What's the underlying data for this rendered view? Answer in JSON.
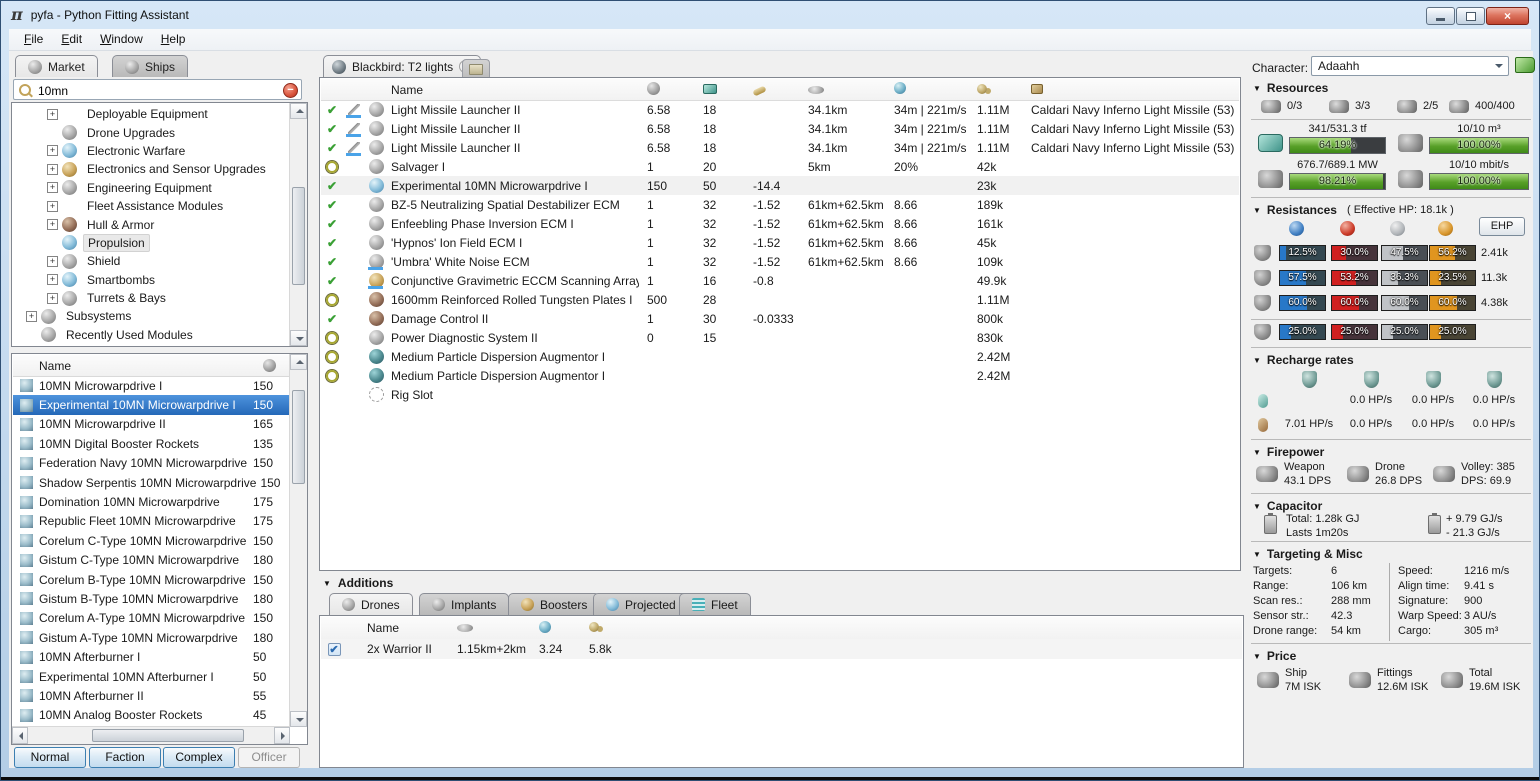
{
  "colors": {
    "selection_blue": "#2f79c8",
    "gauge_green": "#58a028",
    "em": "#2878c8",
    "thermal": "#d02020",
    "kinetic": "#c0c3c7",
    "explosive": "#e0951f",
    "close_button": "#c04530",
    "charge_underline": "#4aa3e8"
  },
  "window": {
    "title": "pyfa - Python Fitting Assistant"
  },
  "menu": {
    "items": [
      {
        "label": "File"
      },
      {
        "label": "Edit"
      },
      {
        "label": "Window"
      },
      {
        "label": "Help"
      }
    ]
  },
  "left_panel": {
    "tabs": [
      {
        "label": "Market",
        "icon": "market-tab-icon",
        "active": true
      },
      {
        "label": "Ships",
        "icon": "ships-tab-icon",
        "active": false
      }
    ],
    "search": {
      "value": "10mn"
    },
    "tree": {
      "items": [
        {
          "label": "Deployable Equipment",
          "plus": true,
          "icon": "",
          "indent": "ind1"
        },
        {
          "label": "Drone Upgrades",
          "plus": false,
          "icon": "drone-upgrades-icon",
          "indent": "ind1"
        },
        {
          "label": "Electronic Warfare",
          "plus": true,
          "icon": "electronic-warfare-icon",
          "indent": "ind1"
        },
        {
          "label": "Electronics and Sensor Upgrades",
          "plus": true,
          "icon": "sensor-upgrades-icon",
          "indent": "ind1"
        },
        {
          "label": "Engineering Equipment",
          "plus": true,
          "icon": "engineering-icon",
          "indent": "ind1"
        },
        {
          "label": "Fleet Assistance Modules",
          "plus": true,
          "icon": "",
          "indent": "ind1"
        },
        {
          "label": "Hull & Armor",
          "plus": true,
          "icon": "hull-armor-icon",
          "indent": "ind1"
        },
        {
          "label": "Propulsion",
          "plus": false,
          "icon": "propulsion-icon",
          "indent": "ind1",
          "selected": true
        },
        {
          "label": "Shield",
          "plus": true,
          "icon": "shield-group-icon",
          "indent": "ind1"
        },
        {
          "label": "Smartbombs",
          "plus": true,
          "icon": "smartbombs-icon",
          "indent": "ind1"
        },
        {
          "label": "Turrets & Bays",
          "plus": true,
          "icon": "turrets-icon",
          "indent": "ind1"
        },
        {
          "label": "Subsystems",
          "plus": true,
          "icon": "subsystems-icon",
          "indent": "ind0"
        },
        {
          "label": "Recently Used Modules",
          "plus": false,
          "icon": "recent-modules-icon",
          "indent": "ind0"
        }
      ]
    },
    "market_list": {
      "name_header": "Name",
      "items": [
        {
          "name": "10MN Microwarpdrive I",
          "pg": "150"
        },
        {
          "name": "Experimental 10MN Microwarpdrive I",
          "pg": "150",
          "selected": true
        },
        {
          "name": "10MN Microwarpdrive II",
          "pg": "165"
        },
        {
          "name": "10MN Digital Booster Rockets",
          "pg": "135"
        },
        {
          "name": "Federation Navy 10MN Microwarpdrive",
          "pg": "150"
        },
        {
          "name": "Shadow Serpentis 10MN Microwarpdrive",
          "pg": "150"
        },
        {
          "name": "Domination 10MN Microwarpdrive",
          "pg": "175"
        },
        {
          "name": "Republic Fleet 10MN Microwarpdrive",
          "pg": "175"
        },
        {
          "name": "Corelum C-Type 10MN Microwarpdrive",
          "pg": "150"
        },
        {
          "name": "Gistum C-Type 10MN Microwarpdrive",
          "pg": "180"
        },
        {
          "name": "Corelum B-Type 10MN Microwarpdrive",
          "pg": "150"
        },
        {
          "name": "Gistum B-Type 10MN Microwarpdrive",
          "pg": "180"
        },
        {
          "name": "Corelum A-Type 10MN Microwarpdrive",
          "pg": "150"
        },
        {
          "name": "Gistum A-Type 10MN Microwarpdrive",
          "pg": "180"
        },
        {
          "name": "10MN Afterburner I",
          "pg": "50"
        },
        {
          "name": "Experimental 10MN Afterburner I",
          "pg": "50"
        },
        {
          "name": "10MN Afterburner II",
          "pg": "55"
        },
        {
          "name": "10MN Analog Booster Rockets",
          "pg": "45"
        }
      ]
    },
    "meta_buttons": [
      {
        "label": "Normal",
        "active": true
      },
      {
        "label": "Faction",
        "active": true
      },
      {
        "label": "Complex",
        "active": true
      },
      {
        "label": "Officer",
        "disabled": true
      }
    ]
  },
  "center": {
    "fit_tab": {
      "label": "Blackbird: T2 lights"
    },
    "fitting": {
      "name_header": "Name",
      "rows": [
        {
          "act": true,
          "charge": true,
          "charge_ul": true,
          "icon": "missile-launcher-icon",
          "name": "Light Missile Launcher II",
          "pg": "6.58",
          "cpu": "18",
          "cap": "",
          "range": "34.1km",
          "falloff": "34m | 221m/s",
          "price": "1.11M",
          "ammo": "Caldari Navy Inferno Light Missile (53)"
        },
        {
          "act": true,
          "charge": true,
          "charge_ul": true,
          "icon": "missile-launcher-icon",
          "name": "Light Missile Launcher II",
          "pg": "6.58",
          "cpu": "18",
          "cap": "",
          "range": "34.1km",
          "falloff": "34m | 221m/s",
          "price": "1.11M",
          "ammo": "Caldari Navy Inferno Light Missile (53)"
        },
        {
          "act": true,
          "charge": true,
          "charge_ul": true,
          "icon": "missile-launcher-icon",
          "name": "Light Missile Launcher II",
          "pg": "6.58",
          "cpu": "18",
          "cap": "",
          "range": "34.1km",
          "falloff": "34m | 221m/s",
          "price": "1.11M",
          "ammo": "Caldari Navy Inferno Light Missile (53)"
        },
        {
          "off": true,
          "icon": "salvager-icon",
          "name": "Salvager I",
          "pg": "1",
          "cpu": "20",
          "cap": "",
          "range": "5km",
          "falloff": "20%",
          "price": "42k",
          "ammo": ""
        },
        {
          "act": true,
          "selected": true,
          "icon": "mwd-icon",
          "name": "Experimental 10MN Microwarpdrive I",
          "pg": "150",
          "cpu": "50",
          "cap": "-14.4",
          "range": "",
          "falloff": "",
          "price": "23k",
          "ammo": ""
        },
        {
          "act": true,
          "icon": "ecm-icon",
          "name": "BZ-5 Neutralizing Spatial Destabilizer ECM",
          "pg": "1",
          "cpu": "32",
          "cap": "-1.52",
          "range": "61km+62.5km",
          "falloff": "8.66",
          "price": "189k",
          "ammo": ""
        },
        {
          "act": true,
          "icon": "ecm-icon",
          "name": "Enfeebling Phase Inversion ECM I",
          "pg": "1",
          "cpu": "32",
          "cap": "-1.52",
          "range": "61km+62.5km",
          "falloff": "8.66",
          "price": "161k",
          "ammo": ""
        },
        {
          "act": true,
          "icon": "ecm-icon",
          "name": "'Hypnos' Ion Field ECM I",
          "pg": "1",
          "cpu": "32",
          "cap": "-1.52",
          "range": "61km+62.5km",
          "falloff": "8.66",
          "price": "45k",
          "ammo": ""
        },
        {
          "act": true,
          "icon_ul": true,
          "icon": "ecm-icon",
          "name": "'Umbra' White Noise ECM",
          "pg": "1",
          "cpu": "32",
          "cap": "-1.52",
          "range": "61km+62.5km",
          "falloff": "8.66",
          "price": "109k",
          "ammo": ""
        },
        {
          "act": true,
          "icon_ul": true,
          "icon": "eccm-icon",
          "name": "Conjunctive Gravimetric ECCM Scanning Array I",
          "pg": "1",
          "cpu": "16",
          "cap": "-0.8",
          "range": "",
          "falloff": "",
          "price": "49.9k",
          "ammo": ""
        },
        {
          "off": true,
          "icon": "armor-plate-icon",
          "name": "1600mm Reinforced Rolled Tungsten Plates I",
          "pg": "500",
          "cpu": "28",
          "cap": "",
          "range": "",
          "falloff": "",
          "price": "1.11M",
          "ammo": ""
        },
        {
          "act": true,
          "icon": "damage-control-icon",
          "name": "Damage Control II",
          "pg": "1",
          "cpu": "30",
          "cap": "-0.0333",
          "range": "",
          "falloff": "",
          "price": "800k",
          "ammo": ""
        },
        {
          "off": true,
          "icon": "pds-icon",
          "name": "Power Diagnostic System II",
          "pg": "0",
          "cpu": "15",
          "cap": "",
          "range": "",
          "falloff": "",
          "price": "830k",
          "ammo": ""
        },
        {
          "off": true,
          "icon": "rig-augmentor-icon",
          "name": "Medium Particle Dispersion Augmentor I",
          "pg": "",
          "cpu": "",
          "cap": "",
          "range": "",
          "falloff": "",
          "price": "2.42M",
          "ammo": ""
        },
        {
          "off": true,
          "icon": "rig-augmentor-icon",
          "name": "Medium Particle Dispersion Augmentor I",
          "pg": "",
          "cpu": "",
          "cap": "",
          "range": "",
          "falloff": "",
          "price": "2.42M",
          "ammo": ""
        },
        {
          "icon": "rig-slot-icon",
          "name": "Rig Slot",
          "pg": "",
          "cpu": "",
          "cap": "",
          "range": "",
          "falloff": "",
          "price": "",
          "ammo": ""
        }
      ]
    },
    "additions": {
      "label": "Additions",
      "tabs": [
        {
          "label": "Drones",
          "icon": "drones-tab-icon",
          "active": true
        },
        {
          "label": "Implants",
          "icon": "implants-tab-icon"
        },
        {
          "label": "Boosters",
          "icon": "boosters-tab-icon"
        },
        {
          "label": "Projected",
          "icon": "projected-tab-icon"
        },
        {
          "label": "Fleet",
          "icon": "fleet-tab-icon"
        }
      ],
      "drones": {
        "name_header": "Name",
        "rows": [
          {
            "checked": true,
            "name": "2x Warrior II",
            "range": "1.15km+2km",
            "tracking": "3.24",
            "price": "5.8k"
          }
        ]
      }
    }
  },
  "right_panel": {
    "character": {
      "label": "Character:",
      "value": "Adaahh"
    },
    "resources": {
      "title": "Resources",
      "slots": [
        {
          "icon": "turret-hardpoints-icon",
          "value": "0/3"
        },
        {
          "icon": "launcher-hardpoints-icon",
          "value": "3/3"
        },
        {
          "icon": "calibration-icon",
          "value": "2/5"
        },
        {
          "icon": "drone-capacity-icon",
          "value": "400/400"
        }
      ],
      "gauges": [
        {
          "icon": "cpu-icon",
          "label": "341/531.3 tf",
          "pct": 64.19,
          "text": "64.19%"
        },
        {
          "icon": "dronebay-icon",
          "label": "10/10 m³",
          "pct": 100,
          "text": "100.00%"
        },
        {
          "icon": "powergrid-icon",
          "label": "676.7/689.1 MW",
          "pct": 98.21,
          "text": "98.21%"
        },
        {
          "icon": "bandwidth-icon",
          "label": "10/10 mbit/s",
          "pct": 100,
          "text": "100.00%"
        }
      ]
    },
    "resistances": {
      "title": "Resistances",
      "subtitle": "( Effective HP: 18.1k )",
      "ehp_button": "EHP",
      "rows": [
        {
          "icon": "shield-resist-icon",
          "cells": [
            {
              "type": "em",
              "value": "12.5%"
            },
            {
              "type": "thermal",
              "value": "30.0%"
            },
            {
              "type": "kinetic",
              "value": "47.5%"
            },
            {
              "type": "explosive",
              "value": "56.2%"
            }
          ],
          "ehp": "2.41k"
        },
        {
          "icon": "armor-resist-icon",
          "cells": [
            {
              "type": "em",
              "value": "57.5%"
            },
            {
              "type": "thermal",
              "value": "53.2%"
            },
            {
              "type": "kinetic",
              "value": "36.3%"
            },
            {
              "type": "explosive",
              "value": "23.5%"
            }
          ],
          "ehp": "11.3k"
        },
        {
          "icon": "hull-resist-icon",
          "cells": [
            {
              "type": "em",
              "value": "60.0%"
            },
            {
              "type": "thermal",
              "value": "60.0%"
            },
            {
              "type": "kinetic",
              "value": "60.0%"
            },
            {
              "type": "explosive",
              "value": "60.0%"
            }
          ],
          "ehp": "4.38k"
        }
      ],
      "profile": {
        "cells": [
          {
            "type": "em",
            "value": "25.0%"
          },
          {
            "type": "thermal",
            "value": "25.0%"
          },
          {
            "type": "kinetic",
            "value": "25.0%"
          },
          {
            "type": "explosive",
            "value": "25.0%"
          }
        ]
      }
    },
    "recharge": {
      "title": "Recharge rates",
      "rows": [
        {
          "icon": "reinforced-rate-icon",
          "values": [
            {
              "v": ""
            },
            {
              "v": "0.0 HP/s"
            },
            {
              "v": "0.0 HP/s"
            },
            {
              "v": "0.0 HP/s"
            }
          ]
        },
        {
          "icon": "sustained-rate-icon",
          "values": [
            {
              "v": "7.01 HP/s"
            },
            {
              "v": "0.0 HP/s"
            },
            {
              "v": "0.0 HP/s"
            },
            {
              "v": "0.0 HP/s"
            }
          ]
        }
      ]
    },
    "firepower": {
      "title": "Firepower",
      "items": [
        {
          "icon": "weapon-dps-icon",
          "line1": "Weapon",
          "line2": "43.1 DPS"
        },
        {
          "icon": "drone-dps-icon",
          "line1": "Drone",
          "line2": "26.8 DPS"
        },
        {
          "icon": "volley-icon",
          "line1": "Volley: 385",
          "line2": "DPS: 69.9"
        }
      ]
    },
    "capacitor": {
      "title": "Capacitor",
      "total_label": "Total: 1.28k GJ",
      "lasts_label": "Lasts 1m20s",
      "plus": "+ 9.79 GJ/s",
      "minus": "- 21.3 GJ/s"
    },
    "targeting": {
      "title": "Targeting & Misc",
      "left": [
        {
          "k": "Targets:",
          "v": "6"
        },
        {
          "k": "Range:",
          "v": "106 km"
        },
        {
          "k": "Scan res.:",
          "v": "288 mm"
        },
        {
          "k": "Sensor str.:",
          "v": "42.3"
        },
        {
          "k": "Drone range:",
          "v": "54 km"
        }
      ],
      "right": [
        {
          "k": "Speed:",
          "v": "1216 m/s"
        },
        {
          "k": "Align time:",
          "v": "9.41 s"
        },
        {
          "k": "Signature:",
          "v": "900"
        },
        {
          "k": "Warp Speed:",
          "v": "3 AU/s"
        },
        {
          "k": "Cargo:",
          "v": "305 m³"
        }
      ]
    },
    "price": {
      "title": "Price",
      "items": [
        {
          "icon": "ship-price-icon",
          "line1": "Ship",
          "line2": "7M ISK"
        },
        {
          "icon": "fittings-price-icon",
          "line1": "Fittings",
          "line2": "12.6M ISK"
        },
        {
          "icon": "total-price-icon",
          "line1": "Total",
          "line2": "19.6M ISK"
        }
      ]
    }
  }
}
